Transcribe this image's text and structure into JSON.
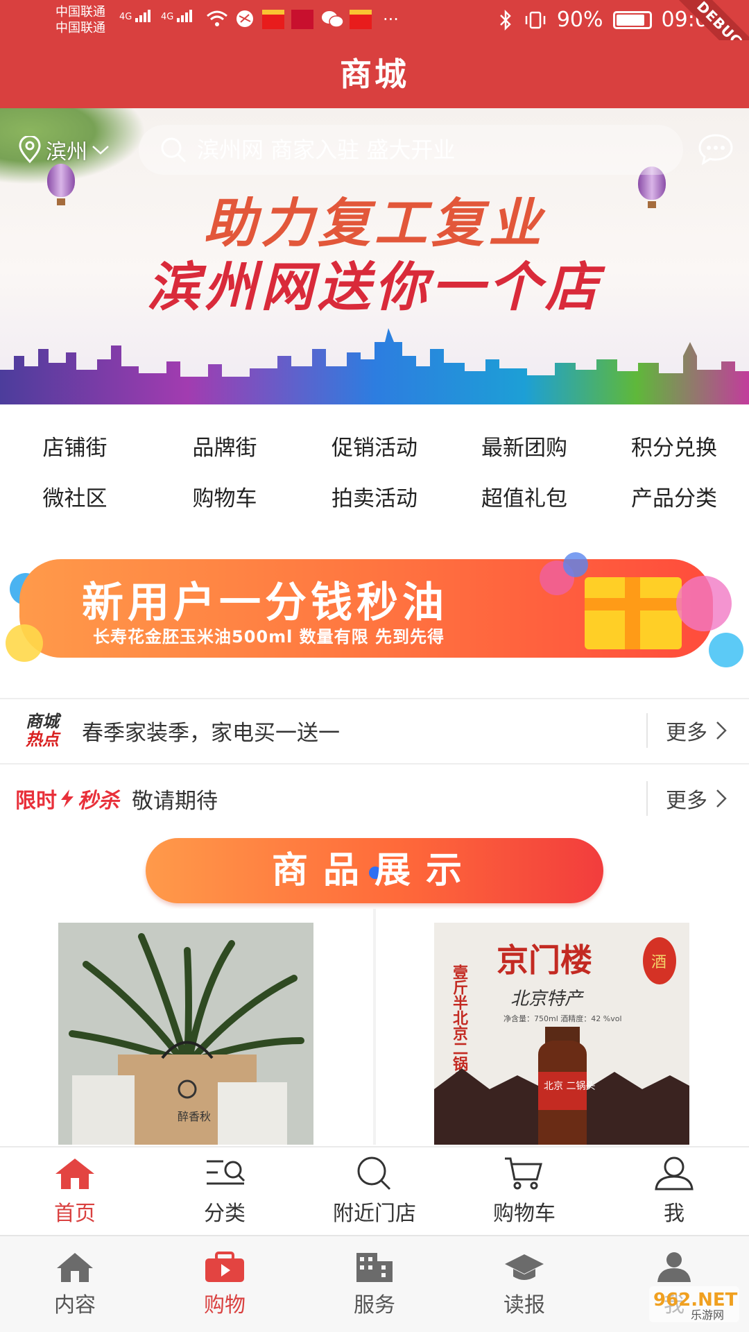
{
  "status_bar": {
    "carrier1": "中国联通",
    "carrier2": "中国联通",
    "net1": "4G",
    "net2": "4G",
    "battery": "90%",
    "time": "09:08",
    "debug": "DEBUG"
  },
  "header": {
    "title": "商城"
  },
  "top": {
    "location": "滨州",
    "search_placeholder": "滨州网 商家入驻 盛大开业"
  },
  "banner": {
    "line1": "助力复工复业",
    "line2": "滨州网送你一个店"
  },
  "categories": [
    {
      "label": "店铺街"
    },
    {
      "label": "品牌街"
    },
    {
      "label": "促销活动"
    },
    {
      "label": "最新团购"
    },
    {
      "label": "积分兑换"
    },
    {
      "label": "微社区"
    },
    {
      "label": "购物车"
    },
    {
      "label": "拍卖活动"
    },
    {
      "label": "超值礼包"
    },
    {
      "label": "产品分类"
    }
  ],
  "promo": {
    "title": "新用户一分钱秒油",
    "subtitle": "长寿花金胚玉米油500ml 数量有限 先到先得"
  },
  "hot": {
    "logo_line1": "商城",
    "logo_line2": "热点",
    "text": "春季家装季，家电买一送一",
    "more": "更多"
  },
  "flash": {
    "label_a": "限时",
    "label_b": "秒杀",
    "text": "敬请期待",
    "more": "更多"
  },
  "section": {
    "title_a": "商品",
    "title_b": "展示"
  },
  "products": [
    {
      "image_text": "醉香秋"
    },
    {
      "image_brand": "京门楼",
      "image_sub": "北京特产",
      "image_vertical": "壹斤半北京二锅头",
      "image_spec": "净含量：750ml 酒精度：42 %vol",
      "image_bottle": "北京 二锅头",
      "image_lantern": "酒"
    }
  ],
  "app_tabs": [
    {
      "label": "首页",
      "icon": "home-icon",
      "active": true
    },
    {
      "label": "分类",
      "icon": "category-icon",
      "active": false
    },
    {
      "label": "附近门店",
      "icon": "search-icon",
      "active": false
    },
    {
      "label": "购物车",
      "icon": "cart-icon",
      "active": false
    },
    {
      "label": "我",
      "icon": "person-icon",
      "active": false
    }
  ],
  "main_tabs": [
    {
      "label": "内容",
      "icon": "house-icon",
      "active": false
    },
    {
      "label": "购物",
      "icon": "shopping-bag-icon",
      "active": true
    },
    {
      "label": "服务",
      "icon": "building-icon",
      "active": false
    },
    {
      "label": "读报",
      "icon": "graduation-cap-icon",
      "active": false
    },
    {
      "label": "我",
      "icon": "user-icon",
      "active": false
    }
  ],
  "watermark": "962.NET",
  "watermark_sub": "乐游网",
  "colors": {
    "brand_red": "#d9403f",
    "promo_orange": "#ff7640",
    "accent_blue": "#2f6ff2"
  }
}
